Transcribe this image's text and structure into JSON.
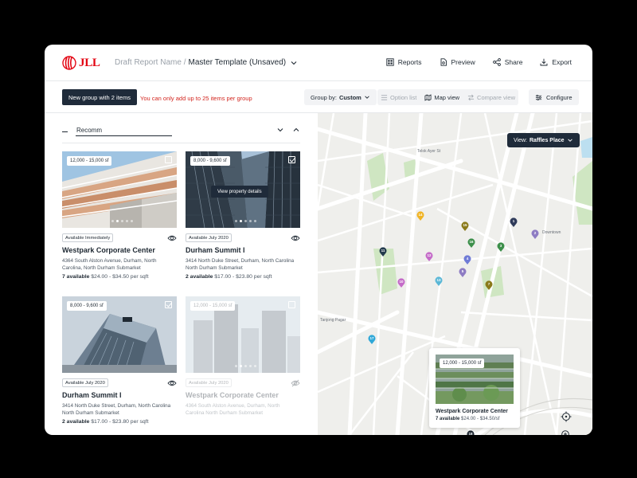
{
  "header": {
    "logo_text": "JLL",
    "breadcrumb_prefix": "Draft Report Name /",
    "report_title": "Master Template (Unsaved)",
    "actions": [
      {
        "label": "Reports",
        "icon": "reports-icon"
      },
      {
        "label": "Preview",
        "icon": "preview-icon"
      },
      {
        "label": "Share",
        "icon": "share-icon"
      },
      {
        "label": "Export",
        "icon": "export-icon"
      }
    ]
  },
  "toolbar": {
    "new_group_label": "New group with 2 items",
    "warning": "You can only add up to 25 items per group",
    "group_by_label": "Group by:",
    "group_by_value": "Custom",
    "option_list": "Option list",
    "map_view": "Map view",
    "compare_view": "Compare view",
    "configure": "Configure"
  },
  "group": {
    "name_value": "Recomm"
  },
  "cards": [
    {
      "size": "12,000 - 15,000 sf",
      "availability": "Available Immediately",
      "title": "Westpark Corporate Center",
      "address": "4364 South Alston Avenue, Durham, North Carolina, North Durham Submarket",
      "available_count": "7 available",
      "price": "$24.00 - $34.50 per sqft",
      "checked": false
    },
    {
      "size": "8,000 - 9,600 sf",
      "availability": "Available July 2020",
      "title": "Durham Summit I",
      "address": "3414 North Duke Street, Durham, North Carolina North Durham Submarket",
      "available_count": "2 available",
      "price": "$17.00 - $23.80 per sqft",
      "checked": true,
      "hover_label": "View property details"
    },
    {
      "size": "8,000 - 9,600 sf",
      "availability": "Available July 2020",
      "title": "Durham Summit I",
      "address": "3414 North Duke Street, Durham, North Carolina North Durham Submarket",
      "available_count": "2 available",
      "price": "$17.00 - $23.80 per sqft",
      "checked": true
    },
    {
      "size": "12,000 - 15,000 sf",
      "availability": "Available July 2020",
      "title": "Westpark Corporate Center",
      "address": "4364 South Alston Avenue, Durham, North Carolina North Durham Submarket",
      "available_count": "",
      "price": "",
      "checked": false,
      "faded": true
    }
  ],
  "map": {
    "view_label": "View:",
    "view_value": "Raffles Place",
    "popup": {
      "size": "12,000 - 15,000 sf",
      "title": "Westpark Corporate Center",
      "available_count": "7 available",
      "price": "$24.00 - $34.50/sf"
    },
    "streets": [
      "Telok Ayer St",
      "Downtown",
      "Tanjong Pagar"
    ],
    "pins": [
      {
        "n": "1",
        "color": "#2e3a59"
      },
      {
        "n": "2",
        "color": "#8e7cc3"
      },
      {
        "n": "3",
        "color": "#3c8f4a"
      },
      {
        "n": "4",
        "color": "#6f7bd6"
      },
      {
        "n": "5",
        "color": "#8e7cc3"
      },
      {
        "n": "7",
        "color": "#8a7a1a"
      },
      {
        "n": "10",
        "color": "#c46bc8"
      },
      {
        "n": "11",
        "color": "#233b4d"
      },
      {
        "n": "12",
        "color": "#c46bc8"
      },
      {
        "n": "13",
        "color": "#5ab7d6"
      },
      {
        "n": "14",
        "color": "#f0b323"
      },
      {
        "n": "15",
        "color": "#8a7a1a"
      },
      {
        "n": "16",
        "color": "#3c8f4a"
      },
      {
        "n": "17",
        "color": "#2fa8d8"
      },
      {
        "n": "18",
        "color": "#1f2933"
      }
    ]
  },
  "colors": {
    "brand_red": "#e30613",
    "dark_navy": "#1f2b3a",
    "warning_red": "#d3261f"
  }
}
